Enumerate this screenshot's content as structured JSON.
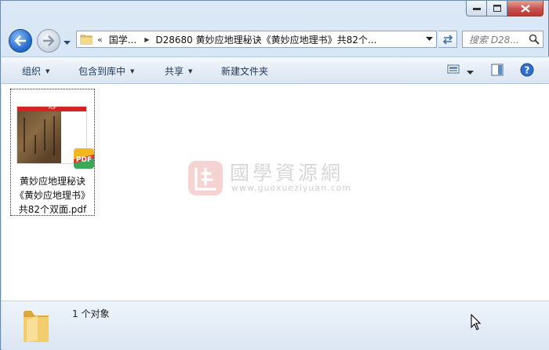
{
  "window": {
    "caption_buttons": [
      "minimize",
      "maximize",
      "close"
    ]
  },
  "address_bar": {
    "chevron": "«",
    "crumbs": [
      "国学...",
      "D28680 黄妙应地理秘诀《黄妙应地理书》共82个..."
    ]
  },
  "search": {
    "placeholder": "搜索 D28..."
  },
  "toolbar": {
    "organize": "组织",
    "include_in_library": "包含到库中",
    "share": "共享",
    "new_folder": "新建文件夹"
  },
  "file": {
    "thumb_header": "PDF",
    "name": "黄妙应地理秘诀《黄妙应地理书》共82个双面.pdf",
    "badge": "PDF"
  },
  "watermark": {
    "title": "國學資源網",
    "url": "www.guoxueziyuan.com"
  },
  "status": {
    "count_text": "1 个对象"
  },
  "colors": {
    "pdf_red": "#d42323",
    "accent_blue": "#2a6fd0",
    "close_red": "#c75050"
  }
}
